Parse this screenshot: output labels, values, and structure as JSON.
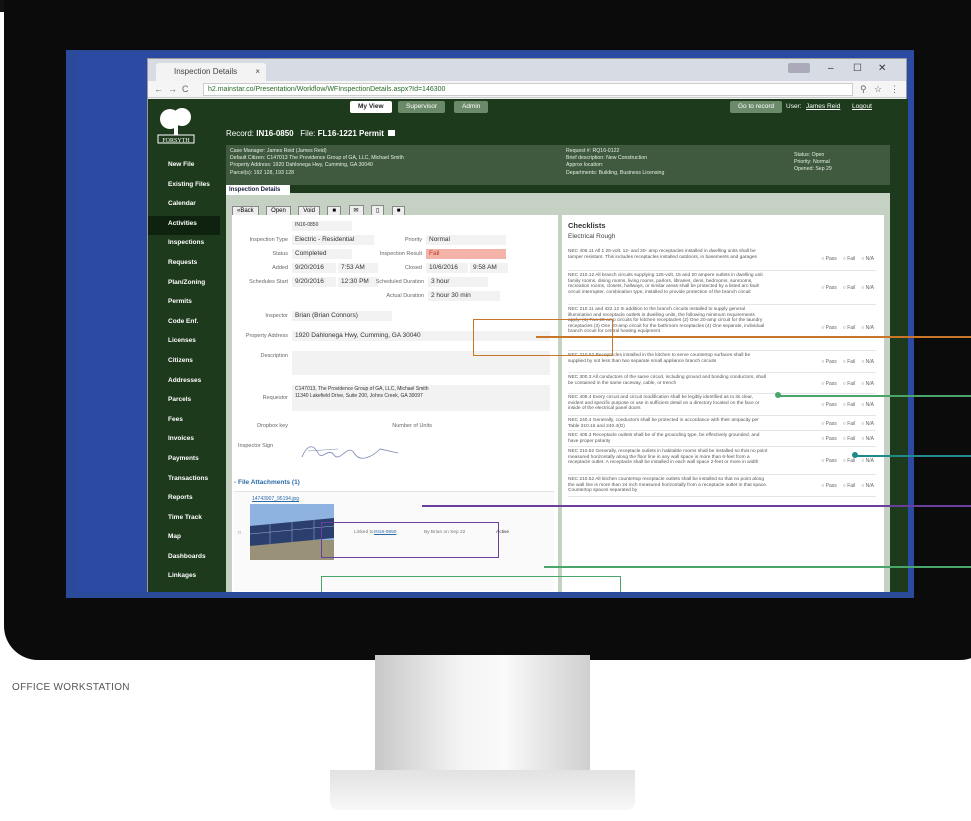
{
  "browser": {
    "tab_title": "Inspection Details",
    "url": "h2.mainstar.co/Presentation/Workflow/WFInspectionDetails.aspx?Id=146300"
  },
  "topnav": {
    "my_view": "My View",
    "supervisor": "Supervisor",
    "admin": "Admin",
    "goto": "Go to record",
    "user_label": "User:",
    "user_name": "James Reid",
    "logout": "Logout"
  },
  "sidebar": {
    "items": [
      "New File",
      "Existing Files",
      "Calendar",
      "Activities",
      "Inspections",
      "Requests",
      "Plan/Zoning",
      "Permits",
      "Code Enf.",
      "Licenses",
      "Citizens",
      "Addresses",
      "Parcels",
      "Fees",
      "Invoices",
      "Payments",
      "Transactions",
      "Reports",
      "Time Track",
      "Map",
      "Dashboards",
      "Linkages"
    ]
  },
  "record": {
    "label": "Record:",
    "id": "IN16-0850",
    "file_label": "File:",
    "file": "FL16-1221 Permit"
  },
  "info": {
    "case_manager": "Case Manager: James Reid (James Reid)",
    "default_citizen": "Default Citizen: C147013 The Providence Group of GA, LLC, Michael Smith",
    "property": "Property Address: 1920 Dahlonega Hwy, Cumming, GA 30040",
    "parcels": "Parcel(s): 192 128, 193 128",
    "request": "Request #: RQ16-0122",
    "brief": "Brief description: New Construction",
    "approx": "Approx location:",
    "departments": "Departments: Building, Business Licensing",
    "status": "Status: Open",
    "priority": "Priority: Normal",
    "opened": "Opened: Sep 29"
  },
  "content_tab": "Inspection Details",
  "toolbar": [
    "«Back",
    "Open",
    "Void"
  ],
  "form": {
    "id": "IN16-0850",
    "type_label": "Inspection Type",
    "type": "Electric - Residential",
    "priority_label": "Priority",
    "priority": "Normal",
    "status_label": "Status",
    "status": "Completed",
    "result_label": "Inspection Result",
    "result": "Fail",
    "added_label": "Added",
    "added_date": "9/20/2016",
    "added_time": "7:53 AM",
    "closed_label": "Closed",
    "closed_date": "10/6/2016",
    "closed_time": "9:58 AM",
    "sched_label": "Schedules Start",
    "sched_date": "9/20/2016",
    "sched_time": "12:30 PM",
    "sched_dur_label": "Scheduled Duration",
    "sched_dur": "3 hour",
    "actual_dur_label": "Actual Duration",
    "actual_dur": "2 hour 30 min",
    "inspector_label": "Inspector",
    "inspector": "Brian (Brian Connors)",
    "address_label": "Property Address",
    "address": "1920 Dahlonega Hwy, Cumming, GA 30040",
    "desc_label": "Description",
    "requestor_label": "Requestor",
    "requestor_1": "C147013, The Providence Group of GA, LLC, Michael Smith",
    "requestor_2": "11340 Lakefield Drive, Suite 200, Johns Creek, GA 30097",
    "dropbox_label": "Dropbox key",
    "units_label": "Number of Units",
    "sign_label": "Inspector Sign",
    "attach_title": "- File Attachments (1)",
    "attach_file": "14743907_95194.jpg",
    "attach_linked": "Linked to",
    "attach_linked_id": "IN16-0850",
    "attach_by": "By Brian on Sep 22",
    "attach_status": "Active"
  },
  "checklists": {
    "title": "Checklists",
    "section": "Electrical Rough",
    "items": [
      "NEC 406.11 All 1 25-volt, 12- and 20- amp receptacles installed in dwelling units shall be tamper resistant. This includes receptacles installed outdoors, in basements and garages",
      "NEC 210.12 All branch circuits supplying 125-volt, 15 and 20 ampere outlets in dwelling unit family rooms, dining rooms, living rooms, parlors, libraries, dens, bedrooms, sunrooms, recreation rooms, closets, hallways, or similar areas shall be protected by a listed arc-fault circuit interrupter, combination type, installed to provide protection of the branch circuit",
      "NEC 210.11 and 422.12 In addition to the branch circuits installed to supply general illumination and receptacle outlets in dwelling units, the following minimum requirements apply: (1) Two 20-amp circuits for kitchen receptacles (2) One 20-amp circuit for the laundry receptacles (3) One 20-amp circuit for the bathroom receptacles (4) One separate, individual branch circuit for central heating equipment",
      "NEC 210.52 Receptacles installed in the kitchen to serve countertop surfaces shall be supplied by not less than two separate small appliance branch circuits",
      "NEC 300.3 All conductors of the same circuit, including ground and bonding conductors, shall be contained in the same raceway, cable, or trench",
      "NEC 408.4 Every circuit and circuit modification shall be legibly identified as to its clear, evident and specific purpose or use in sufficient detail on a directory located on the face or inside of the electrical panel doors",
      "NEC 240.4 Generally, conductors shall be protected in accordance with their ampacity per Table 310.16 and 240.4(D)",
      "NEC 406.3 Receptacle outlets shall be of the grounding type, be effectively grounded, and have proper polarity",
      "NEC 210.52 Generally, receptacle outlets in habitable rooms shall be installed so that no point measured horizontally along the floor line in any wall space is more than 6-feet from a receptacle outlet. A receptacle shall be installed in each wall space 2-feet or more in width",
      "NEC 210.52 All kitchen countertop receptacle outlets shall be installed so that no point along the wall line is more than 24 inch measured horizontally from a receptacle outlet in that space. Countertop spaces separated by"
    ],
    "options": [
      "Pass",
      "Fail",
      "N/A"
    ]
  },
  "caption": "OFFICE WORKSTATION",
  "colors": {
    "callout_orange": "#c7762a",
    "callout_purple": "#6a3f9c",
    "callout_green": "#4aa56a",
    "callout_teal": "#1f8a8a"
  }
}
